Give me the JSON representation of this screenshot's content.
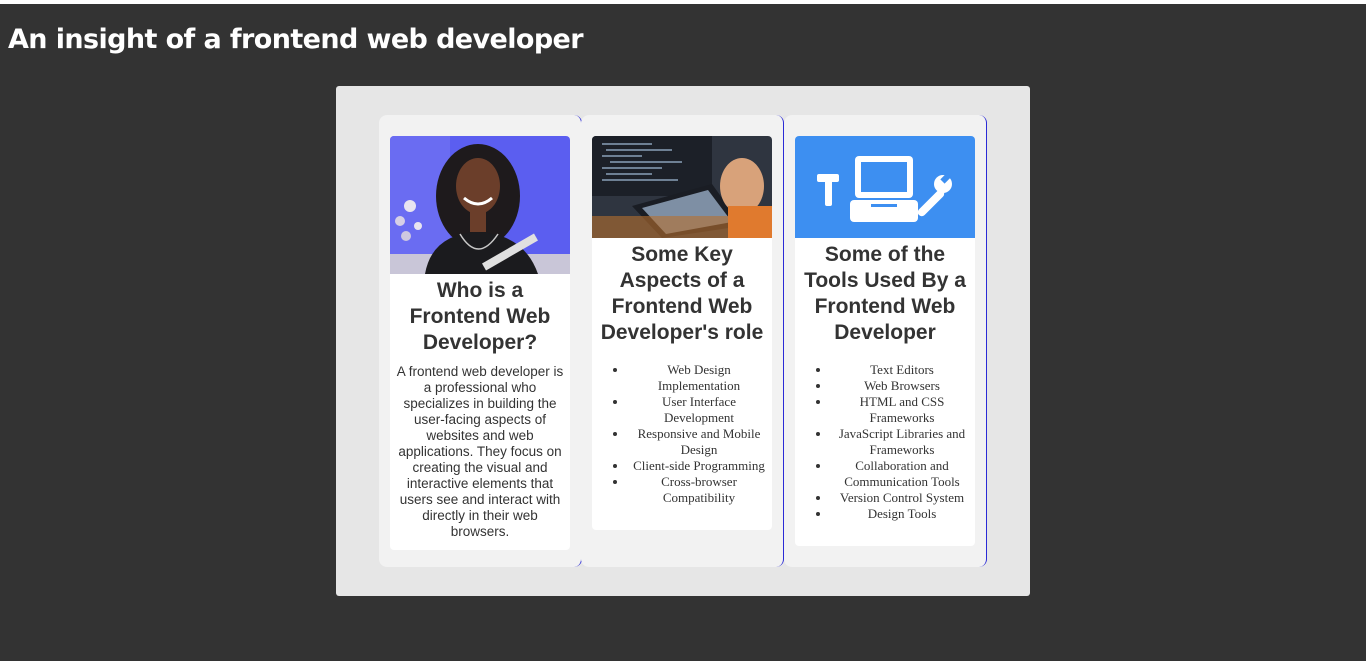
{
  "page": {
    "title": "An insight of a frontend web developer"
  },
  "cards": [
    {
      "title": "Who is a Frontend Web Developer?",
      "description": "A frontend web developer is a professional who specializes in building the user-facing aspects of websites and web applications. They focus on creating the visual and interactive elements that users see and interact with directly in their web browsers."
    },
    {
      "title": "Some Key Aspects of a Frontend Web Developer's role",
      "items": [
        "Web Design Implementation",
        "User Interface Development",
        "Responsive and Mobile Design",
        "Client-side Programming",
        "Cross-browser Compatibility"
      ]
    },
    {
      "title": "Some of the Tools Used By a Frontend Web Developer",
      "items": [
        "Text Editors",
        "Web Browsers",
        "HTML and CSS Frameworks",
        "JavaScript Libraries and Frameworks",
        "Collaboration and Communication Tools",
        "Version Control System",
        "Design Tools"
      ]
    }
  ],
  "colors": {
    "background": "#333333",
    "panel": "#e6e6e6",
    "card_column": "#f2f2f2",
    "card": "#ffffff",
    "accent_border": "#2b2bd6",
    "tools_image_bg": "#3d8ff1"
  },
  "icons": [
    "hammer-icon",
    "laptop-icon",
    "wrench-icon"
  ]
}
